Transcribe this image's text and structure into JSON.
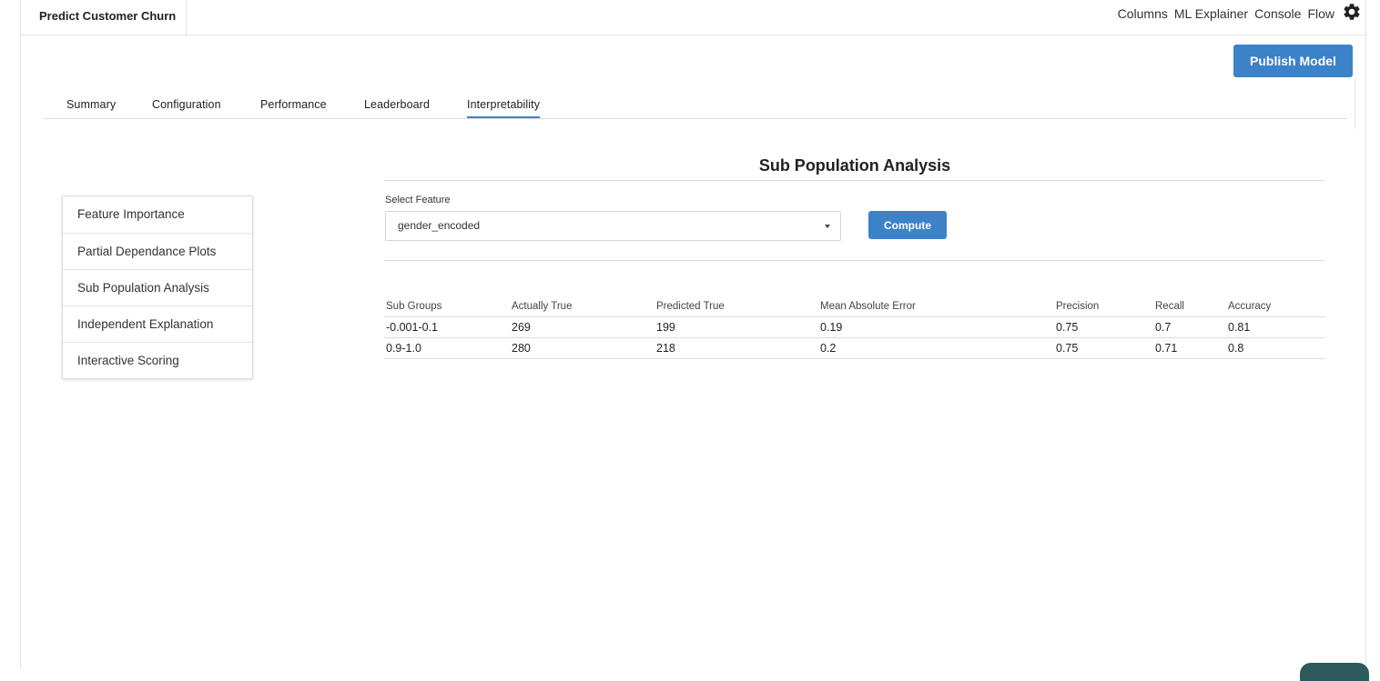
{
  "app": {
    "title": "Predict Customer Churn"
  },
  "topnav": {
    "items": [
      "Columns",
      "ML Explainer",
      "Console",
      "Flow"
    ]
  },
  "actions": {
    "publish_label": "Publish Model"
  },
  "tabs": [
    "Summary",
    "Configuration",
    "Performance",
    "Leaderboard",
    "Interpretability"
  ],
  "active_tab": "Interpretability",
  "sidebar": {
    "items": [
      "Feature Importance",
      "Partial Dependance Plots",
      "Sub Population Analysis",
      "Independent Explanation",
      "Interactive Scoring"
    ]
  },
  "analysis": {
    "title": "Sub Population Analysis",
    "select_label": "Select Feature",
    "selected_feature": "gender_encoded",
    "compute_label": "Compute"
  },
  "table": {
    "headers": [
      "Sub Groups",
      "Actually True",
      "Predicted True",
      "Mean Absolute Error",
      "Precision",
      "Recall",
      "Accuracy"
    ],
    "rows": [
      [
        "-0.001-0.1",
        "269",
        "199",
        "0.19",
        "0.75",
        "0.7",
        "0.81"
      ],
      [
        "0.9-1.0",
        "280",
        "218",
        "0.2",
        "0.75",
        "0.71",
        "0.8"
      ]
    ]
  },
  "colors": {
    "accent": "#3b82c9",
    "chat_widget": "#2d5a5a"
  },
  "icons": {
    "settings": "gear-icon",
    "dropdown": "caret-down-icon"
  }
}
